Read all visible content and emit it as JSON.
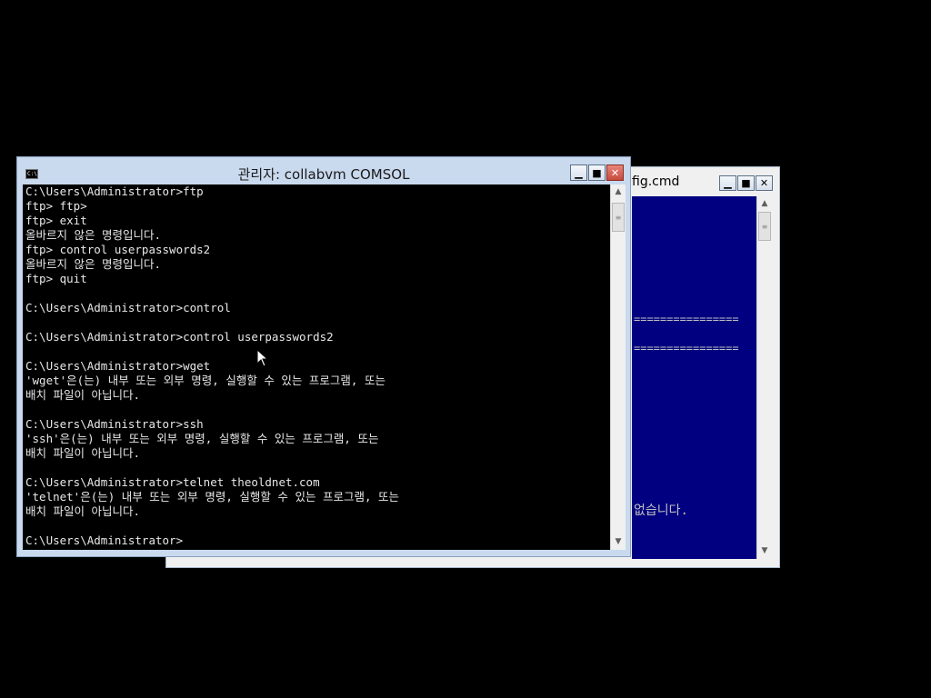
{
  "back_window": {
    "title": "fig.cmd",
    "lines": [
      {
        "text": "================"
      },
      {
        "text": "================"
      },
      {
        "text": "없습니다."
      }
    ],
    "bg_color": "#000080"
  },
  "front_window": {
    "title": "관리자:  collabvm COMSOL",
    "icon": "C:\\",
    "console_lines": [
      "C:\\Users\\Administrator>ftp",
      "ftp> ftp>",
      "ftp> exit",
      "올바르지 않은 명령입니다.",
      "ftp> control userpasswords2",
      "올바르지 않은 명령입니다.",
      "ftp> quit",
      "",
      "C:\\Users\\Administrator>control",
      "",
      "C:\\Users\\Administrator>control userpasswords2",
      "",
      "C:\\Users\\Administrator>wget",
      "'wget'은(는) 내부 또는 외부 명령, 실행할 수 있는 프로그램, 또는",
      "배치 파일이 아닙니다.",
      "",
      "C:\\Users\\Administrator>ssh",
      "'ssh'은(는) 내부 또는 외부 명령, 실행할 수 있는 프로그램, 또는",
      "배치 파일이 아닙니다.",
      "",
      "C:\\Users\\Administrator>telnet theoldnet.com",
      "'telnet'은(는) 내부 또는 외부 명령, 실행할 수 있는 프로그램, 또는",
      "배치 파일이 아닙니다.",
      "",
      "C:\\Users\\Administrator>"
    ]
  },
  "icons": {
    "minimize": "minimize-icon",
    "maximize": "maximize-icon",
    "close": "close-icon",
    "scroll_up": "chevron-up-icon",
    "scroll_down": "chevron-down-icon"
  }
}
